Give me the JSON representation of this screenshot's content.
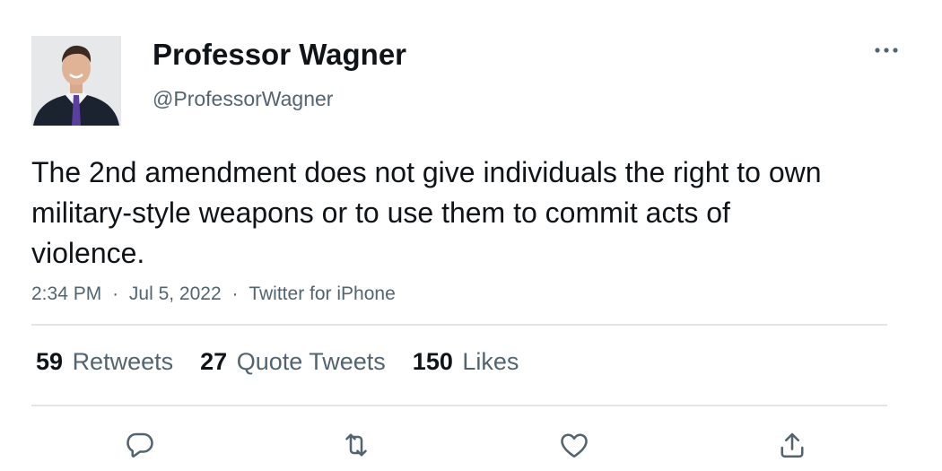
{
  "author": {
    "display_name": "Professor Wagner",
    "handle": "@ProfessorWagner",
    "avatar_icon": "profile-photo"
  },
  "tweet": {
    "text": "The 2nd amendment does not give individuals the right to own military-style weapons or to use them to commit acts of violence.",
    "time": "2:34 PM",
    "date": "Jul 5, 2022",
    "source": "Twitter for iPhone",
    "separator": "·"
  },
  "stats": {
    "retweets": {
      "count": "59",
      "label": "Retweets"
    },
    "quote_tweets": {
      "count": "27",
      "label": "Quote Tweets"
    },
    "likes": {
      "count": "150",
      "label": "Likes"
    }
  },
  "actions": {
    "reply_icon": "reply-icon",
    "retweet_icon": "retweet-icon",
    "like_icon": "heart-icon",
    "share_icon": "share-icon"
  },
  "colors": {
    "text_primary": "#0f1419",
    "text_secondary": "#536471",
    "icon": "#536471",
    "divider": "#e3e6e8"
  }
}
